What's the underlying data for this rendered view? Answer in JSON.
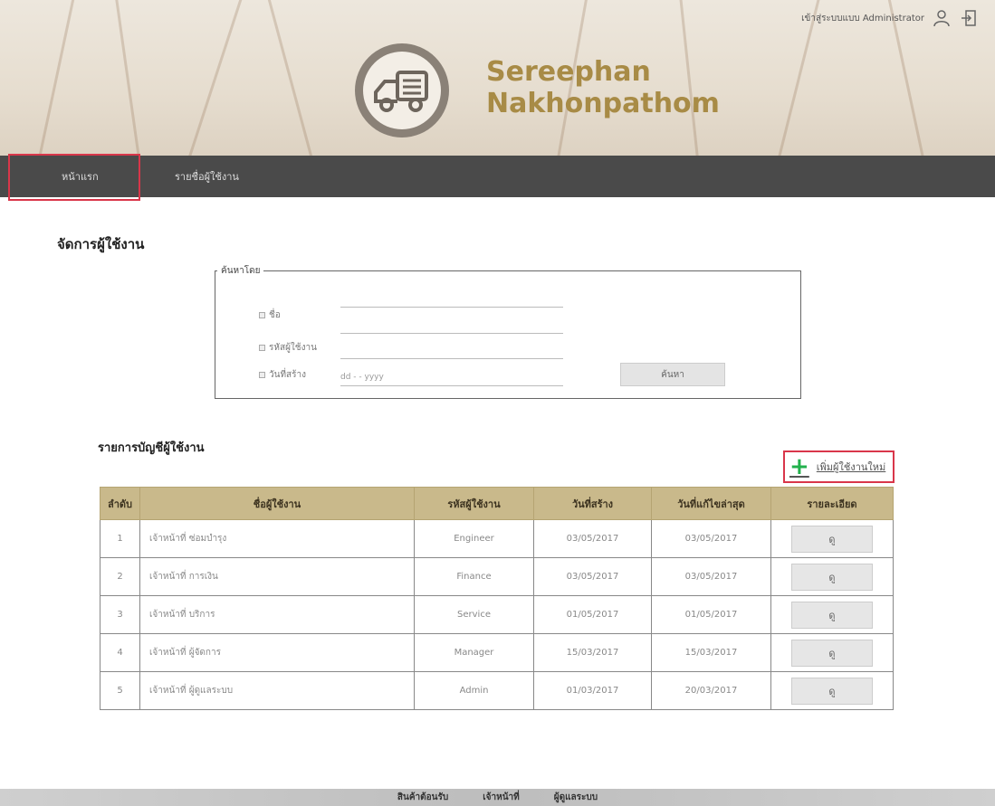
{
  "header": {
    "brand_line1": "Sereephan",
    "brand_line2": "Nakhonpathom",
    "login_text": "เข้าสู่ระบบแบบ Administrator",
    "icons": {
      "user": "user-icon",
      "logout": "logout-icon",
      "logo": "delivery-truck-icon"
    }
  },
  "nav": {
    "home": "หน้าแรก",
    "user_list": "รายชื่อผู้ใช้งาน"
  },
  "page_title": "จัดการผู้ใช้งาน",
  "search": {
    "legend": "ค้นหาโดย",
    "criteria": [
      {
        "label": "ชื่อ"
      },
      {
        "label": "รหัสผู้ใช้งาน"
      },
      {
        "label": "วันที่สร้าง"
      }
    ],
    "date_placeholder": "dd - - yyyy",
    "button": "ค้นหา"
  },
  "list": {
    "title": "รายการบัญชีผู้ใช้งาน",
    "add_button": "เพิ่มผู้ใช้งานใหม่",
    "columns": [
      "ลำดับ",
      "ชื่อผู้ใช้งาน",
      "รหัสผู้ใช้งาน",
      "วันที่สร้าง",
      "วันที่แก้ไขล่าสุด",
      "รายละเอียด"
    ],
    "rows": [
      {
        "no": "1",
        "name": "เจ้าหน้าที่ ซ่อมบำรุง",
        "code": "Engineer",
        "created": "03/05/2017",
        "modified": "03/05/2017",
        "detail": "ดู"
      },
      {
        "no": "2",
        "name": "เจ้าหน้าที่ การเงิน",
        "code": "Finance",
        "created": "03/05/2017",
        "modified": "03/05/2017",
        "detail": "ดู"
      },
      {
        "no": "3",
        "name": "เจ้าหน้าที่ บริการ",
        "code": "Service",
        "created": "01/05/2017",
        "modified": "01/05/2017",
        "detail": "ดู"
      },
      {
        "no": "4",
        "name": "เจ้าหน้าที่ ผู้จัดการ",
        "code": "Manager",
        "created": "15/03/2017",
        "modified": "15/03/2017",
        "detail": "ดู"
      },
      {
        "no": "5",
        "name": "เจ้าหน้าที่ ผู้ดูแลระบบ",
        "code": "Admin",
        "created": "01/03/2017",
        "modified": "20/03/2017",
        "detail": "ดู"
      }
    ]
  },
  "footer": {
    "items": [
      "สินค้าต้อนรับ",
      "เจ้าหน้าที่",
      "ผู้ดูแลระบบ"
    ]
  },
  "colors": {
    "brand": "#a88b46",
    "nav_bg": "#4a4a4a",
    "table_header": "#c9b98b",
    "highlight": "#d9364a",
    "add_icon": "#22b14c"
  }
}
